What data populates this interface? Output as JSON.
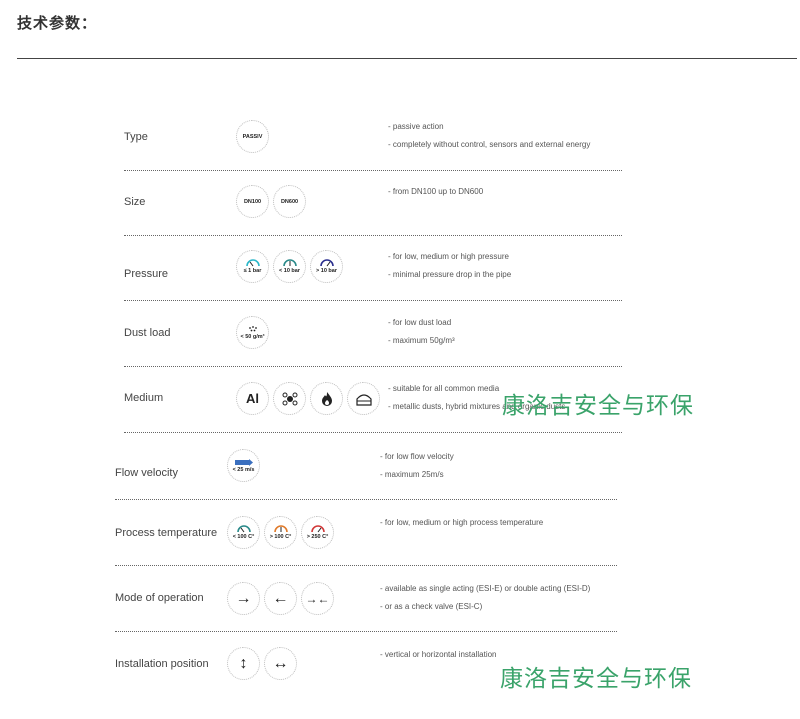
{
  "heading": "技术参数：",
  "rows": [
    {
      "label": "Type",
      "icons": [
        {
          "text": "PASSIV"
        }
      ],
      "desc": [
        "- passive action",
        "- completely without control, sensors and external energy"
      ]
    },
    {
      "label": "Size",
      "icons": [
        {
          "text": "DN100"
        },
        {
          "text": "DN600"
        }
      ],
      "desc": [
        "- from DN100 up to DN600"
      ]
    },
    {
      "label": "Pressure",
      "icons": [
        {
          "text": "≤ 1 bar"
        },
        {
          "text": "< 10 bar"
        },
        {
          "text": "> 10 bar"
        }
      ],
      "desc": [
        "- for low, medium or high pressure",
        "- minimal pressure drop in the pipe"
      ]
    },
    {
      "label": "Dust load",
      "icons": [
        {
          "text": "< 50 g/m³"
        }
      ],
      "desc": [
        "- for low dust load",
        "- maximum 50g/m³"
      ]
    },
    {
      "label": "Medium",
      "icons": [
        {
          "text": "Al"
        },
        {
          "text": ""
        },
        {
          "text": ""
        },
        {
          "text": ""
        }
      ],
      "desc": [
        "- suitable for all common media",
        "- metallic dusts, hybrid mixtures and organic dusts"
      ]
    },
    {
      "label": "Flow velocity",
      "icons": [
        {
          "text": "< 25 m/s"
        }
      ],
      "desc": [
        "- for low flow velocity",
        "- maximum 25m/s"
      ]
    },
    {
      "label": "Process temperature",
      "icons": [
        {
          "text": "< 100 C°"
        },
        {
          "text": "> 100 C°"
        },
        {
          "text": "> 250 C°"
        }
      ],
      "desc": [
        "- for low, medium or high process temperature"
      ]
    },
    {
      "label": "Mode of operation",
      "icons": [
        {
          "text": "→"
        },
        {
          "text": "←"
        },
        {
          "text": "→←"
        }
      ],
      "desc": [
        "- available as single acting (ESI-E) or double acting (ESI-D)",
        "- or as a check valve (ESI-C)"
      ]
    },
    {
      "label": "Installation position",
      "icons": [
        {
          "text": "↕"
        },
        {
          "text": "↔"
        }
      ],
      "desc": [
        "- vertical or horizontal installation"
      ]
    }
  ],
  "watermark": "康洛吉安全与环保",
  "colors": {
    "cyan": "#2ab7c9",
    "teal": "#2a8a8a",
    "navy": "#2b2f8f",
    "orange": "#e07a2a",
    "red": "#d23a3a",
    "watermark": "#3aa36a"
  }
}
